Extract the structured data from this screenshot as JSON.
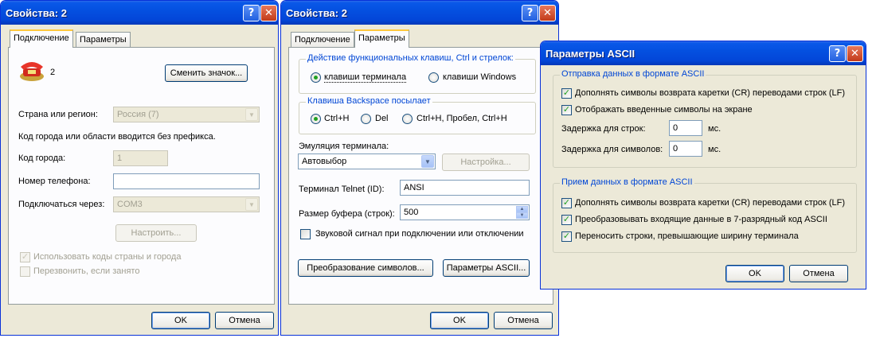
{
  "win1": {
    "title": "Свойства: 2",
    "tabs": [
      "Подключение",
      "Параметры"
    ],
    "connection_name": "2",
    "change_icon_button": "Сменить значок...",
    "country_label": "Страна или регион:",
    "country_value": "Россия (7)",
    "hint": "Код города или области вводится без префикса.",
    "area_code_label": "Код города:",
    "area_code_value": "1",
    "phone_label": "Номер телефона:",
    "phone_value": "",
    "connect_via_label": "Подключаться через:",
    "connect_via_value": "COM3",
    "configure_button": "Настроить...",
    "use_codes_label": "Использовать коды страны и города",
    "redial_label": "Перезвонить, если занято",
    "ok": "OK",
    "cancel": "Отмена"
  },
  "win2": {
    "title": "Свойства: 2",
    "tabs": [
      "Подключение",
      "Параметры"
    ],
    "fkeys_group": "Действие функциональных клавиш, Ctrl и стрелок:",
    "fkeys_terminal": "клавиши терминала",
    "fkeys_windows": "клавиши Windows",
    "backspace_group": "Клавиша  Backspace посылает",
    "bs_ctrlh": "Ctrl+H",
    "bs_del": "Del",
    "bs_combo": "Ctrl+H, Пробел, Ctrl+H",
    "emulation_label": "Эмуляция терминала:",
    "emulation_value": "Автовыбор",
    "settings_button": "Настройка...",
    "telnet_label": "Терминал Telnet (ID):",
    "telnet_value": "ANSI",
    "buffer_label": "Размер буфера (строк):",
    "buffer_value": "500",
    "sound_label": "Звуковой сигнал при подключении или отключении",
    "char_conv_button": "Преобразование символов...",
    "ascii_button": "Параметры ASCII...",
    "ok": "OK",
    "cancel": "Отмена"
  },
  "win3": {
    "title": "Параметры ASCII",
    "send_group": "Отправка данных в формате ASCII",
    "send_append_lf": "Дополнять символы возврата каретки (CR) переводами строк (LF)",
    "send_echo": "Отображать введенные символы на экране",
    "line_delay_label": "Задержка для строк:",
    "line_delay_value": "0",
    "char_delay_label": "Задержка для символов:",
    "char_delay_value": "0",
    "ms": "мс.",
    "recv_group": "Прием данных в формате ASCII",
    "recv_append_lf": "Дополнять символы возврата каретки (CR) переводами строк (LF)",
    "recv_7bit": "Преобразовывать входящие данные в 7-разрядный код ASCII",
    "recv_wrap": "Переносить строки, превышающие ширину терминала",
    "ok": "OK",
    "cancel": "Отмена"
  },
  "title_buttons": {
    "help": "?",
    "close": "✕"
  }
}
